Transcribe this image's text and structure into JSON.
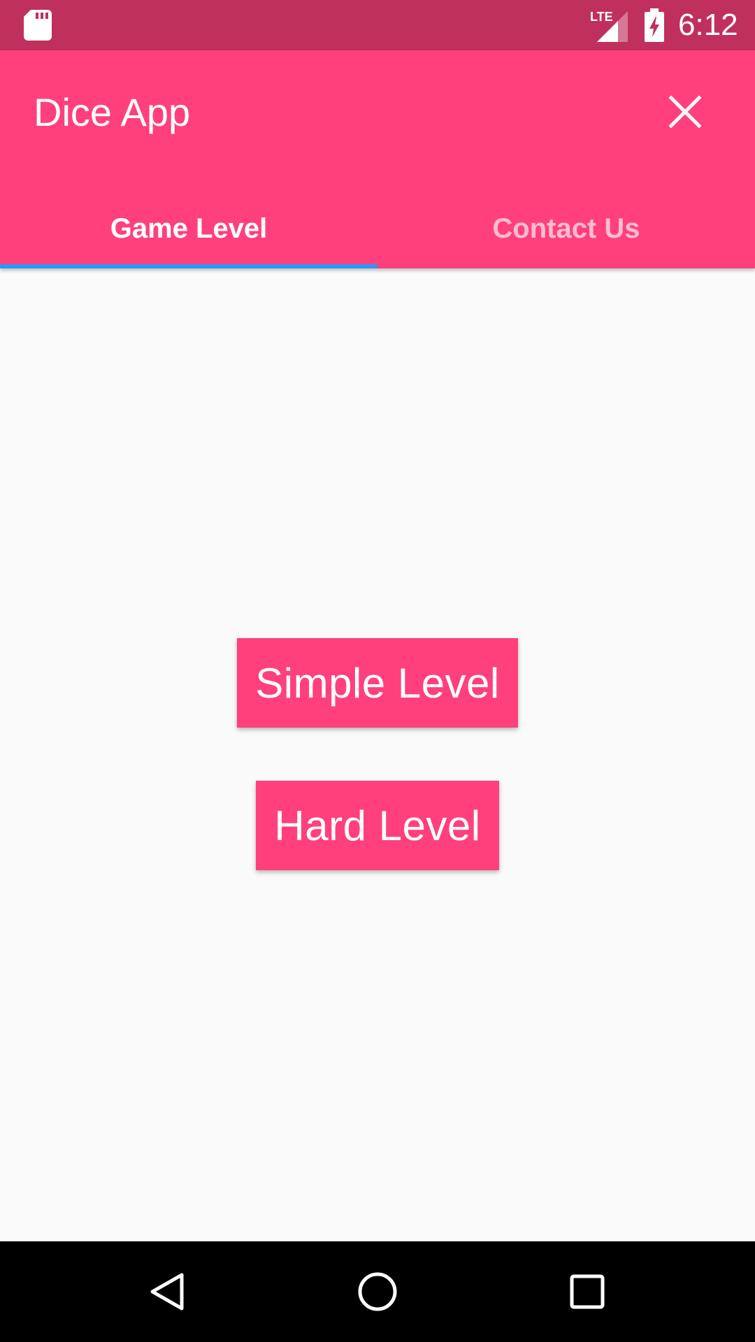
{
  "status_bar": {
    "time": "6:12",
    "network": "LTE",
    "icons": [
      "sd-card-icon",
      "signal-icon",
      "battery-charging-icon"
    ]
  },
  "app_bar": {
    "title": "Dice App",
    "close_icon": "close-icon"
  },
  "tabs": [
    {
      "label": "Game Level",
      "active": true
    },
    {
      "label": "Contact Us",
      "active": false
    }
  ],
  "main": {
    "simple_button": "Simple Level",
    "hard_button": "Hard Level"
  },
  "nav_bar": {
    "icons": [
      "back-icon",
      "home-icon",
      "recents-icon"
    ]
  },
  "colors": {
    "status_bar": "#c0305d",
    "primary": "#ff407c",
    "tab_indicator": "#2f96f3",
    "background": "#fafafa"
  }
}
